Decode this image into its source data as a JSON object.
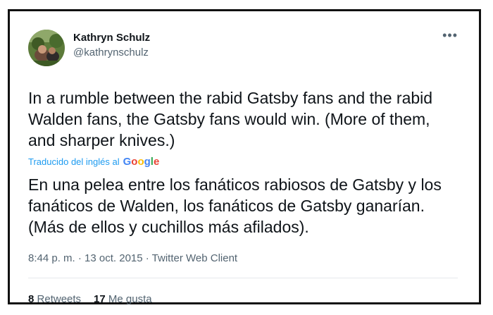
{
  "author": {
    "name": "Kathryn Schulz",
    "handle": "@kathrynschulz"
  },
  "more_menu": "•••",
  "tweet": {
    "text": "In a rumble between the rabid Gatsby fans and the rabid Walden fans, the Gatsby fans would win. (More of them, and sharper knives.)",
    "translated_label": "Traducido del inglés al",
    "translator_logo": "Google",
    "translation": "En una pelea entre los fanáticos rabiosos de Gatsby y los fanáticos de Walden, los fanáticos de Gatsby ganarían. (Más de ellos y cuchillos más afilados).",
    "meta": "8:44 p. m. · 13 oct. 2015 · Twitter Web Client"
  },
  "stats": {
    "retweets_count": "8",
    "retweets_label": "Retweets",
    "likes_count": "17",
    "likes_label": "Me gusta"
  },
  "colors": {
    "link": "#1d9bf0",
    "text": "#0f1419",
    "muted": "#536471"
  }
}
